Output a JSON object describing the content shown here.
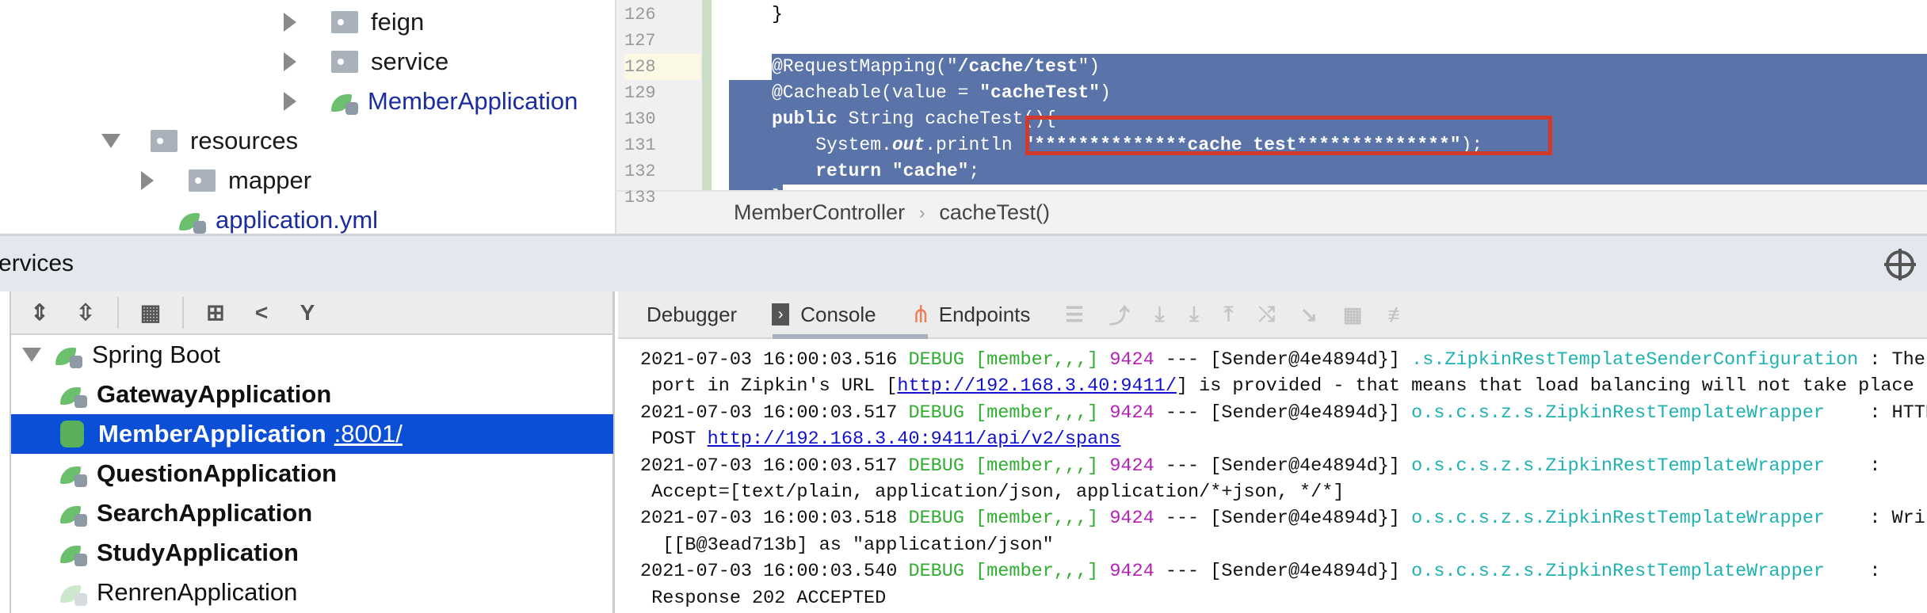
{
  "project_tree": [
    {
      "label": "feign",
      "type": "folder",
      "state": "collapsed"
    },
    {
      "label": "service",
      "type": "folder",
      "state": "collapsed"
    },
    {
      "label": "MemberApplication",
      "type": "spring-class",
      "state": "collapsed"
    },
    {
      "label": "resources",
      "type": "resources-folder",
      "state": "expanded"
    },
    {
      "label": "mapper",
      "type": "folder",
      "state": "collapsed"
    },
    {
      "label": "application.yml",
      "type": "yml"
    }
  ],
  "editor": {
    "line_numbers": [
      "126",
      "127",
      "128",
      "129",
      "130",
      "131",
      "132",
      "133"
    ],
    "lines": [
      [
        {
          "t": "    }",
          "k": ""
        }
      ],
      [
        {
          "t": "",
          "k": ""
        }
      ],
      [
        {
          "t": "    @RequestMapping(\"",
          "k": ""
        },
        {
          "t": "/cache/test",
          "k": "str"
        },
        {
          "t": "\")",
          "k": ""
        }
      ],
      [
        {
          "t": "    @Cacheable(value = ",
          "k": ""
        },
        {
          "t": "\"cacheTest\"",
          "k": "str"
        },
        {
          "t": ")",
          "k": ""
        }
      ],
      [
        {
          "t": "    ",
          "k": ""
        },
        {
          "t": "public",
          "k": "kw"
        },
        {
          "t": " String cacheTest(){",
          "k": ""
        }
      ],
      [
        {
          "t": "        System.",
          "k": ""
        },
        {
          "t": "out",
          "k": "it"
        },
        {
          "t": ".println ",
          "k": ""
        },
        {
          "t": "\"**************cache test**************\"",
          "k": "str"
        },
        {
          "t": ");",
          "k": ""
        }
      ],
      [
        {
          "t": "        ",
          "k": ""
        },
        {
          "t": "return",
          "k": "kw"
        },
        {
          "t": " ",
          "k": ""
        },
        {
          "t": "\"cache\"",
          "k": "str"
        },
        {
          "t": ";",
          "k": ""
        }
      ],
      [
        {
          "t": "    }",
          "k": ""
        }
      ]
    ],
    "breadcrumb": [
      "MemberController",
      "cacheTest()"
    ]
  },
  "services": {
    "title": "Services",
    "toolbar": [
      "expand-all",
      "collapse-all",
      "group-by",
      "add-service",
      "new-configuration",
      "filter"
    ],
    "tree": {
      "root": "Spring Boot",
      "items": [
        {
          "label": "GatewayApplication",
          "bold": true
        },
        {
          "label": "MemberApplication",
          "port": ":8001/",
          "bold": true,
          "selected": true
        },
        {
          "label": "QuestionApplication",
          "bold": true
        },
        {
          "label": "SearchApplication",
          "bold": true
        },
        {
          "label": "StudyApplication",
          "bold": true
        },
        {
          "label": "RenrenApplication",
          "bold": false
        }
      ]
    }
  },
  "console": {
    "tabs": [
      "Debugger",
      "Console",
      "Endpoints"
    ],
    "active_tab": "Console",
    "lines": [
      [
        {
          "t": "2021-07-03 16:00:03.516 ",
          "k": ""
        },
        {
          "t": "DEBUG [member,,,]",
          "k": "dbg"
        },
        {
          "t": " ",
          "k": ""
        },
        {
          "t": "9424",
          "k": "pid"
        },
        {
          "t": " --- [Sender@4e4894d}] ",
          "k": ""
        },
        {
          "t": ".s.ZipkinRestTemplateSenderConfiguration",
          "k": "lg"
        },
        {
          "t": " : The",
          "k": ""
        }
      ],
      [
        {
          "t": " port in Zipkin's URL [",
          "k": ""
        },
        {
          "t": "http://192.168.3.40:9411/",
          "k": "lnk"
        },
        {
          "t": "] is provided - that means that load balancing will not take place",
          "k": ""
        }
      ],
      [
        {
          "t": "2021-07-03 16:00:03.517 ",
          "k": ""
        },
        {
          "t": "DEBUG [member,,,]",
          "k": "dbg"
        },
        {
          "t": " ",
          "k": ""
        },
        {
          "t": "9424",
          "k": "pid"
        },
        {
          "t": " --- [Sender@4e4894d}] ",
          "k": ""
        },
        {
          "t": "o.s.c.s.z.s.ZipkinRestTemplateWrapper",
          "k": "lg"
        },
        {
          "t": "    : HTTP",
          "k": ""
        }
      ],
      [
        {
          "t": " POST ",
          "k": ""
        },
        {
          "t": "http://192.168.3.40:9411/api/v2/spans",
          "k": "lnk"
        }
      ],
      [
        {
          "t": "2021-07-03 16:00:03.517 ",
          "k": ""
        },
        {
          "t": "DEBUG [member,,,]",
          "k": "dbg"
        },
        {
          "t": " ",
          "k": ""
        },
        {
          "t": "9424",
          "k": "pid"
        },
        {
          "t": " --- [Sender@4e4894d}] ",
          "k": ""
        },
        {
          "t": "o.s.c.s.z.s.ZipkinRestTemplateWrapper",
          "k": "lg"
        },
        {
          "t": "    :",
          "k": ""
        }
      ],
      [
        {
          "t": " Accept=[text/plain, application/json, application/*+json, */*]",
          "k": ""
        }
      ],
      [
        {
          "t": "2021-07-03 16:00:03.518 ",
          "k": ""
        },
        {
          "t": "DEBUG [member,,,]",
          "k": "dbg"
        },
        {
          "t": " ",
          "k": ""
        },
        {
          "t": "9424",
          "k": "pid"
        },
        {
          "t": " --- [Sender@4e4894d}] ",
          "k": ""
        },
        {
          "t": "o.s.c.s.z.s.ZipkinRestTemplateWrapper",
          "k": "lg"
        },
        {
          "t": "    : Writ",
          "k": ""
        }
      ],
      [
        {
          "t": "  [[B@3ead713b] as \"application/json\"",
          "k": ""
        }
      ],
      [
        {
          "t": "2021-07-03 16:00:03.540 ",
          "k": ""
        },
        {
          "t": "DEBUG [member,,,]",
          "k": "dbg"
        },
        {
          "t": " ",
          "k": ""
        },
        {
          "t": "9424",
          "k": "pid"
        },
        {
          "t": " --- [Sender@4e4894d}] ",
          "k": ""
        },
        {
          "t": "o.s.c.s.z.s.ZipkinRestTemplateWrapper",
          "k": "lg"
        },
        {
          "t": "    :",
          "k": ""
        }
      ],
      [
        {
          "t": " Response 202 ACCEPTED",
          "k": ""
        }
      ]
    ]
  },
  "colors": {
    "selection": "#5a73a8",
    "highlight_box": "#d0392b",
    "selected_row": "#0b4fd6",
    "debug": "#2fae2f",
    "pid": "#b520b5",
    "logger": "#20b2b2"
  }
}
